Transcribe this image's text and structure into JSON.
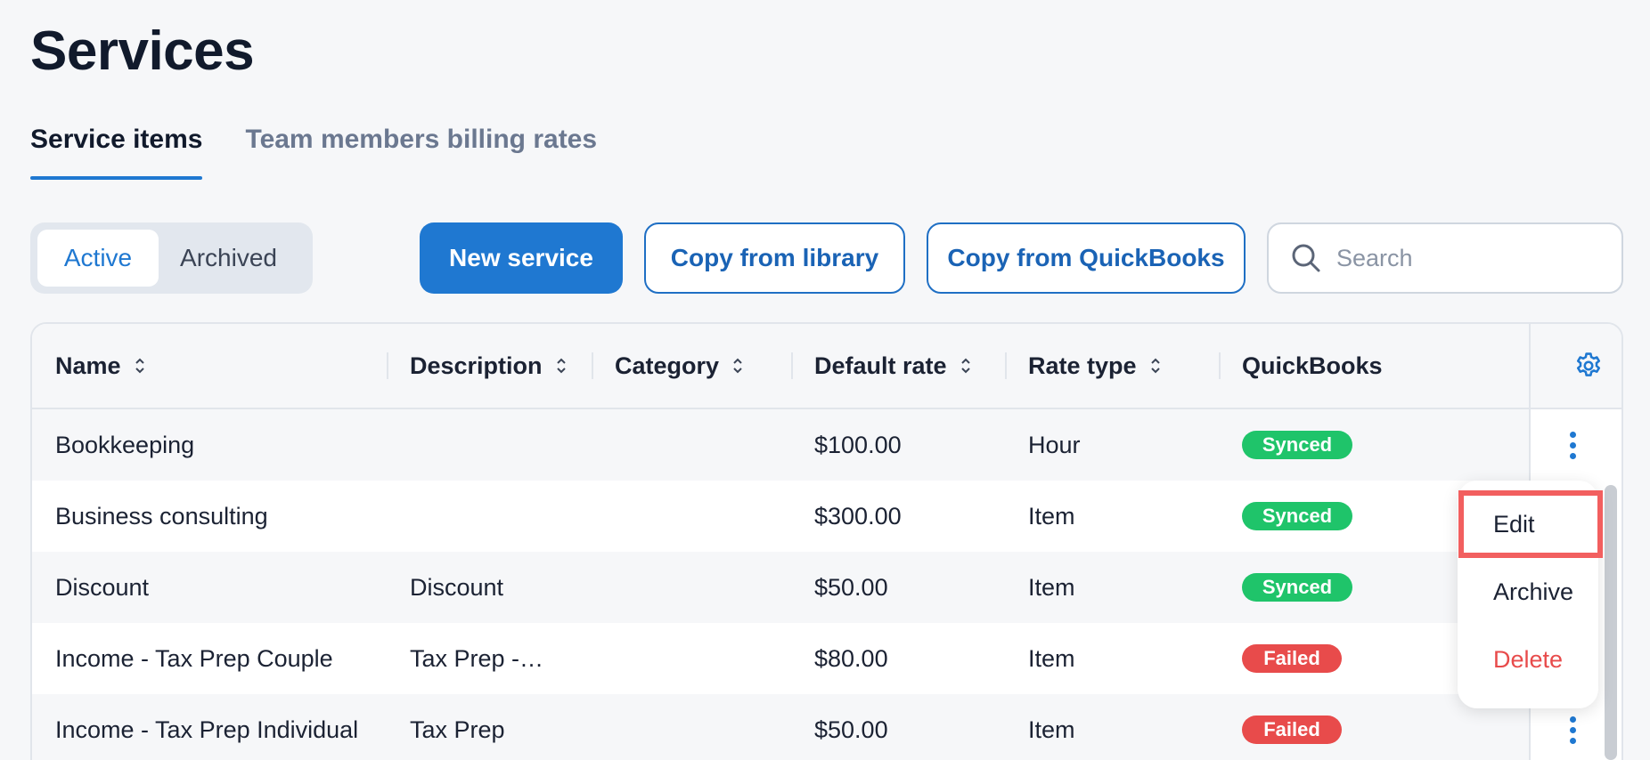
{
  "page_title": "Services",
  "tabs": [
    {
      "label": "Service items",
      "active": true
    },
    {
      "label": "Team members billing rates",
      "active": false
    }
  ],
  "filter_toggle": {
    "active_label": "Active",
    "archived_label": "Archived",
    "selected": "Active"
  },
  "toolbar": {
    "new_service_label": "New service",
    "copy_library_label": "Copy from library",
    "copy_quickbooks_label": "Copy from QuickBooks"
  },
  "search": {
    "placeholder": "Search",
    "value": ""
  },
  "table": {
    "columns": [
      "Name",
      "Description",
      "Category",
      "Default rate",
      "Rate type",
      "QuickBooks"
    ],
    "rows": [
      {
        "name": "Bookkeeping",
        "description": "",
        "category": "",
        "rate": "$100.00",
        "rate_type": "Hour",
        "status": "Synced"
      },
      {
        "name": "Business consulting",
        "description": "",
        "category": "",
        "rate": "$300.00",
        "rate_type": "Item",
        "status": "Synced"
      },
      {
        "name": "Discount",
        "description": "Discount",
        "category": "",
        "rate": "$50.00",
        "rate_type": "Item",
        "status": "Synced"
      },
      {
        "name": "Income - Tax Prep Couple",
        "description": "Tax Prep -…",
        "category": "",
        "rate": "$80.00",
        "rate_type": "Item",
        "status": "Failed"
      },
      {
        "name": "Income - Tax Prep Individual",
        "description": "Tax Prep",
        "category": "",
        "rate": "$50.00",
        "rate_type": "Item",
        "status": "Failed"
      }
    ]
  },
  "context_menu": {
    "edit": "Edit",
    "archive": "Archive",
    "delete": "Delete"
  },
  "icons": {
    "search": "search-icon",
    "settings": "gear-icon",
    "row_actions": "kebab-menu-icon",
    "sort": "sort-icon"
  },
  "colors": {
    "accent": "#1f78d1",
    "synced": "#1fc46a",
    "failed": "#e84b4b",
    "highlight": "#f25f5f"
  }
}
